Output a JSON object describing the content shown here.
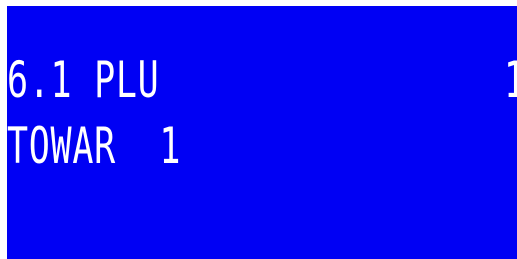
{
  "display": {
    "line1_left": "6.1 PLU",
    "line1_right": "1",
    "line2": "TOWAR  1"
  },
  "colors": {
    "background": "#0000f4",
    "text": "#ffffff",
    "border": "#ffffff"
  }
}
